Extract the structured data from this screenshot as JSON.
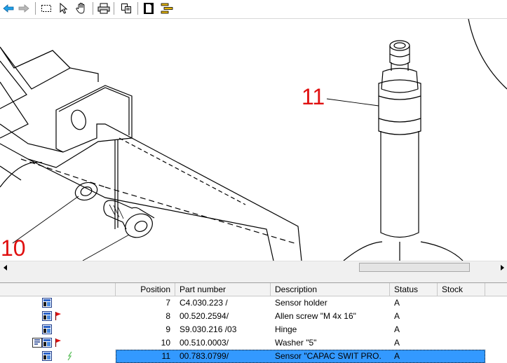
{
  "toolbar": {
    "buttons": [
      {
        "icon": "back-arrow-icon"
      },
      {
        "icon": "forward-arrow-icon"
      },
      {
        "icon": "rectangle-select-icon"
      },
      {
        "icon": "pointer-icon"
      },
      {
        "icon": "hand-pan-icon"
      },
      {
        "icon": "printer-icon"
      },
      {
        "icon": "copy-icon"
      },
      {
        "icon": "page-icon"
      },
      {
        "icon": "tree-list-icon"
      }
    ]
  },
  "drawing": {
    "callouts": [
      {
        "label": "11"
      },
      {
        "label": "10"
      }
    ]
  },
  "table": {
    "columns": [
      "Position",
      "Part number",
      "Description",
      "Status",
      "Stock"
    ],
    "rows": [
      {
        "position": "7",
        "part_number": "C4.030.223 /",
        "description": "Sensor holder",
        "status": "A",
        "stock": "",
        "flag": false,
        "extra_icon": false,
        "selected": false
      },
      {
        "position": "8",
        "part_number": "00.520.2594/",
        "description": "Allen screw \"M 4x 16\"",
        "status": "A",
        "stock": "",
        "flag": true,
        "extra_icon": false,
        "selected": false
      },
      {
        "position": "9",
        "part_number": "S9.030.216 /03",
        "description": "Hinge",
        "status": "A",
        "stock": "",
        "flag": false,
        "extra_icon": false,
        "selected": false
      },
      {
        "position": "10",
        "part_number": "00.510.0003/",
        "description": "Washer \"5\"",
        "status": "A",
        "stock": "",
        "flag": true,
        "extra_icon": true,
        "selected": false
      },
      {
        "position": "11",
        "part_number": "00.783.0799/",
        "description": "Sensor \"CAPAC SWIT PRO.",
        "status": "A",
        "stock": "",
        "flag": false,
        "extra_icon": false,
        "selected": true
      }
    ]
  },
  "colors": {
    "selection": "#3399ff",
    "callout": "#e01010",
    "flag": "#e01010"
  }
}
